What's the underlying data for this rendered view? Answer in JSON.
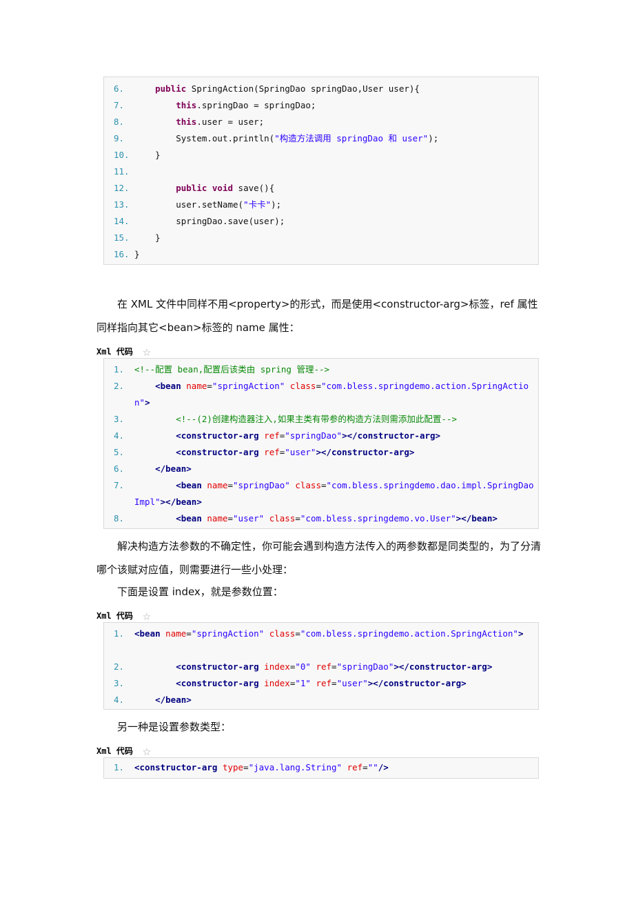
{
  "java_block": {
    "lines": [
      {
        "n": "6.",
        "parts": [
          [
            "",
            "    "
          ],
          [
            "kw",
            "public"
          ],
          [
            "",
            " SpringAction(SpringDao springDao,User user){"
          ]
        ]
      },
      {
        "n": "7.",
        "parts": [
          [
            "",
            "        "
          ],
          [
            "kw",
            "this"
          ],
          [
            "",
            ".springDao = springDao;"
          ]
        ]
      },
      {
        "n": "8.",
        "parts": [
          [
            "",
            "        "
          ],
          [
            "kw",
            "this"
          ],
          [
            "",
            ".user = user;"
          ]
        ]
      },
      {
        "n": "9.",
        "parts": [
          [
            "",
            "        System.out.println("
          ],
          [
            "str",
            "\"构造方法调用 springDao 和 user\""
          ],
          [
            "",
            ");"
          ]
        ]
      },
      {
        "n": "10.",
        "parts": [
          [
            "",
            "    }"
          ]
        ]
      },
      {
        "n": "11.",
        "parts": [
          [
            "",
            ""
          ]
        ]
      },
      {
        "n": "12.",
        "parts": [
          [
            "",
            "        "
          ],
          [
            "kw",
            "public"
          ],
          [
            "",
            " "
          ],
          [
            "kw",
            "void"
          ],
          [
            "",
            " save(){"
          ]
        ]
      },
      {
        "n": "13.",
        "parts": [
          [
            "",
            "        user.setName("
          ],
          [
            "str",
            "\"卡卡\""
          ],
          [
            "",
            ");"
          ]
        ]
      },
      {
        "n": "14.",
        "parts": [
          [
            "",
            "        springDao.save(user);"
          ]
        ]
      },
      {
        "n": "15.",
        "parts": [
          [
            "",
            "    }"
          ]
        ]
      },
      {
        "n": "16.",
        "parts": [
          [
            "",
            "}"
          ]
        ]
      }
    ]
  },
  "para1": "　　在 XML 文件中同样不用<property>的形式，而是使用<constructor-arg>标签，ref 属性同样指向其它<bean>标签的 name 属性：",
  "label1": "Xml 代码",
  "xml_block1": {
    "lines": [
      {
        "n": "1.",
        "parts": [
          [
            "cmt",
            "<!--配置 bean,配置后该类由 spring 管理-->"
          ]
        ]
      },
      {
        "n": "2.",
        "wrap": true,
        "parts": [
          [
            "",
            "    "
          ],
          [
            "tag",
            "<bean"
          ],
          [
            "",
            " "
          ],
          [
            "attr",
            "name"
          ],
          [
            "",
            "="
          ],
          [
            "val",
            "\"springAction\""
          ],
          [
            "",
            " "
          ],
          [
            "attr",
            "class"
          ],
          [
            "",
            "="
          ],
          [
            "val",
            "\"com.bless.springdemo.action.SpringAction\""
          ],
          [
            "tag",
            ">"
          ]
        ]
      },
      {
        "n": "3.",
        "parts": [
          [
            "",
            "        "
          ],
          [
            "cmt",
            "<!--(2)创建构造器注入,如果主类有带参的构造方法则需添加此配置-->"
          ]
        ]
      },
      {
        "n": "4.",
        "parts": [
          [
            "",
            "        "
          ],
          [
            "tag",
            "<constructor-arg"
          ],
          [
            "",
            " "
          ],
          [
            "attr",
            "ref"
          ],
          [
            "",
            "="
          ],
          [
            "val",
            "\"springDao\""
          ],
          [
            "tag",
            "></constructor-arg>"
          ]
        ]
      },
      {
        "n": "5.",
        "parts": [
          [
            "",
            "        "
          ],
          [
            "tag",
            "<constructor-arg"
          ],
          [
            "",
            " "
          ],
          [
            "attr",
            "ref"
          ],
          [
            "",
            "="
          ],
          [
            "val",
            "\"user\""
          ],
          [
            "tag",
            "></constructor-arg>"
          ]
        ]
      },
      {
        "n": "6.",
        "parts": [
          [
            "",
            "    "
          ],
          [
            "tag",
            "</bean>"
          ]
        ]
      },
      {
        "n": "7.",
        "wrap": true,
        "parts": [
          [
            "",
            "        "
          ],
          [
            "tag",
            "<bean"
          ],
          [
            "",
            " "
          ],
          [
            "attr",
            "name"
          ],
          [
            "",
            "="
          ],
          [
            "val",
            "\"springDao\""
          ],
          [
            "",
            " "
          ],
          [
            "attr",
            "class"
          ],
          [
            "",
            "="
          ],
          [
            "val",
            "\"com.bless.springdemo.dao.impl.SpringDaoImpl\""
          ],
          [
            "tag",
            "></bean>"
          ]
        ]
      },
      {
        "n": "8.",
        "parts": [
          [
            "",
            "        "
          ],
          [
            "tag",
            "<bean"
          ],
          [
            "",
            " "
          ],
          [
            "attr",
            "name"
          ],
          [
            "",
            "="
          ],
          [
            "val",
            "\"user\""
          ],
          [
            "",
            " "
          ],
          [
            "attr",
            "class"
          ],
          [
            "",
            "="
          ],
          [
            "val",
            "\"com.bless.springdemo.vo.User\""
          ],
          [
            "tag",
            "></bean>"
          ]
        ]
      }
    ]
  },
  "para2": "　　解决构造方法参数的不确定性，你可能会遇到构造方法传入的两参数都是同类型的，为了分清哪个该赋对应值，则需要进行一些小处理：",
  "para3": "　　下面是设置 index，就是参数位置：",
  "label2": "Xml 代码",
  "xml_block2": {
    "lines": [
      {
        "n": "1.",
        "wrap": true,
        "parts": [
          [
            "tag",
            "<bean"
          ],
          [
            "",
            " "
          ],
          [
            "attr",
            "name"
          ],
          [
            "",
            "="
          ],
          [
            "val",
            "\"springAction\""
          ],
          [
            "",
            " "
          ],
          [
            "attr",
            "class"
          ],
          [
            "",
            "="
          ],
          [
            "val",
            "\"com.bless.springdemo.action.SpringAction\""
          ],
          [
            "tag",
            ">"
          ]
        ]
      },
      {
        "n": "2.",
        "parts": [
          [
            "",
            "        "
          ],
          [
            "tag",
            "<constructor-arg"
          ],
          [
            "",
            " "
          ],
          [
            "attr",
            "index"
          ],
          [
            "",
            "="
          ],
          [
            "val",
            "\"0\""
          ],
          [
            "",
            " "
          ],
          [
            "attr",
            "ref"
          ],
          [
            "",
            "="
          ],
          [
            "val",
            "\"springDao\""
          ],
          [
            "tag",
            "></constructor-arg>"
          ]
        ]
      },
      {
        "n": "3.",
        "parts": [
          [
            "",
            "        "
          ],
          [
            "tag",
            "<constructor-arg"
          ],
          [
            "",
            " "
          ],
          [
            "attr",
            "index"
          ],
          [
            "",
            "="
          ],
          [
            "val",
            "\"1\""
          ],
          [
            "",
            " "
          ],
          [
            "attr",
            "ref"
          ],
          [
            "",
            "="
          ],
          [
            "val",
            "\"user\""
          ],
          [
            "tag",
            "></constructor-arg>"
          ]
        ]
      },
      {
        "n": "4.",
        "parts": [
          [
            "",
            "    "
          ],
          [
            "tag",
            "</bean>"
          ]
        ]
      }
    ]
  },
  "para4": "　　另一种是设置参数类型：",
  "label3": "Xml 代码",
  "xml_block3": {
    "lines": [
      {
        "n": "1.",
        "parts": [
          [
            "tag",
            "<constructor-arg"
          ],
          [
            "",
            " "
          ],
          [
            "attr",
            "type"
          ],
          [
            "",
            "="
          ],
          [
            "val",
            "\"java.lang.String\""
          ],
          [
            "",
            " "
          ],
          [
            "attr",
            "ref"
          ],
          [
            "",
            "="
          ],
          [
            "val",
            "\"\""
          ],
          [
            "tag",
            "/>"
          ]
        ]
      }
    ]
  },
  "icons": {
    "copy": "star-icon"
  }
}
